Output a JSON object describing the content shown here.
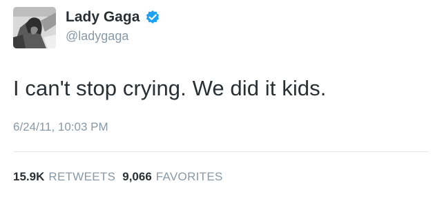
{
  "tweet": {
    "author": {
      "display_name": "Lady Gaga",
      "handle": "@ladygaga",
      "verified_icon": "verified-badge-icon",
      "avatar": "profile-photo"
    },
    "text": "I can't stop crying. We did it kids.",
    "timestamp": "6/24/11, 10:03 PM",
    "stats": {
      "retweets_count": "15.9K",
      "retweets_label": "RETWEETS",
      "favorites_count": "9,066",
      "favorites_label": "FAVORITES"
    }
  },
  "colors": {
    "text_primary": "#292f33",
    "text_secondary": "#8899a6",
    "verified_blue": "#1da1f2",
    "divider": "#e1e8ed",
    "background": "#ffffff"
  }
}
